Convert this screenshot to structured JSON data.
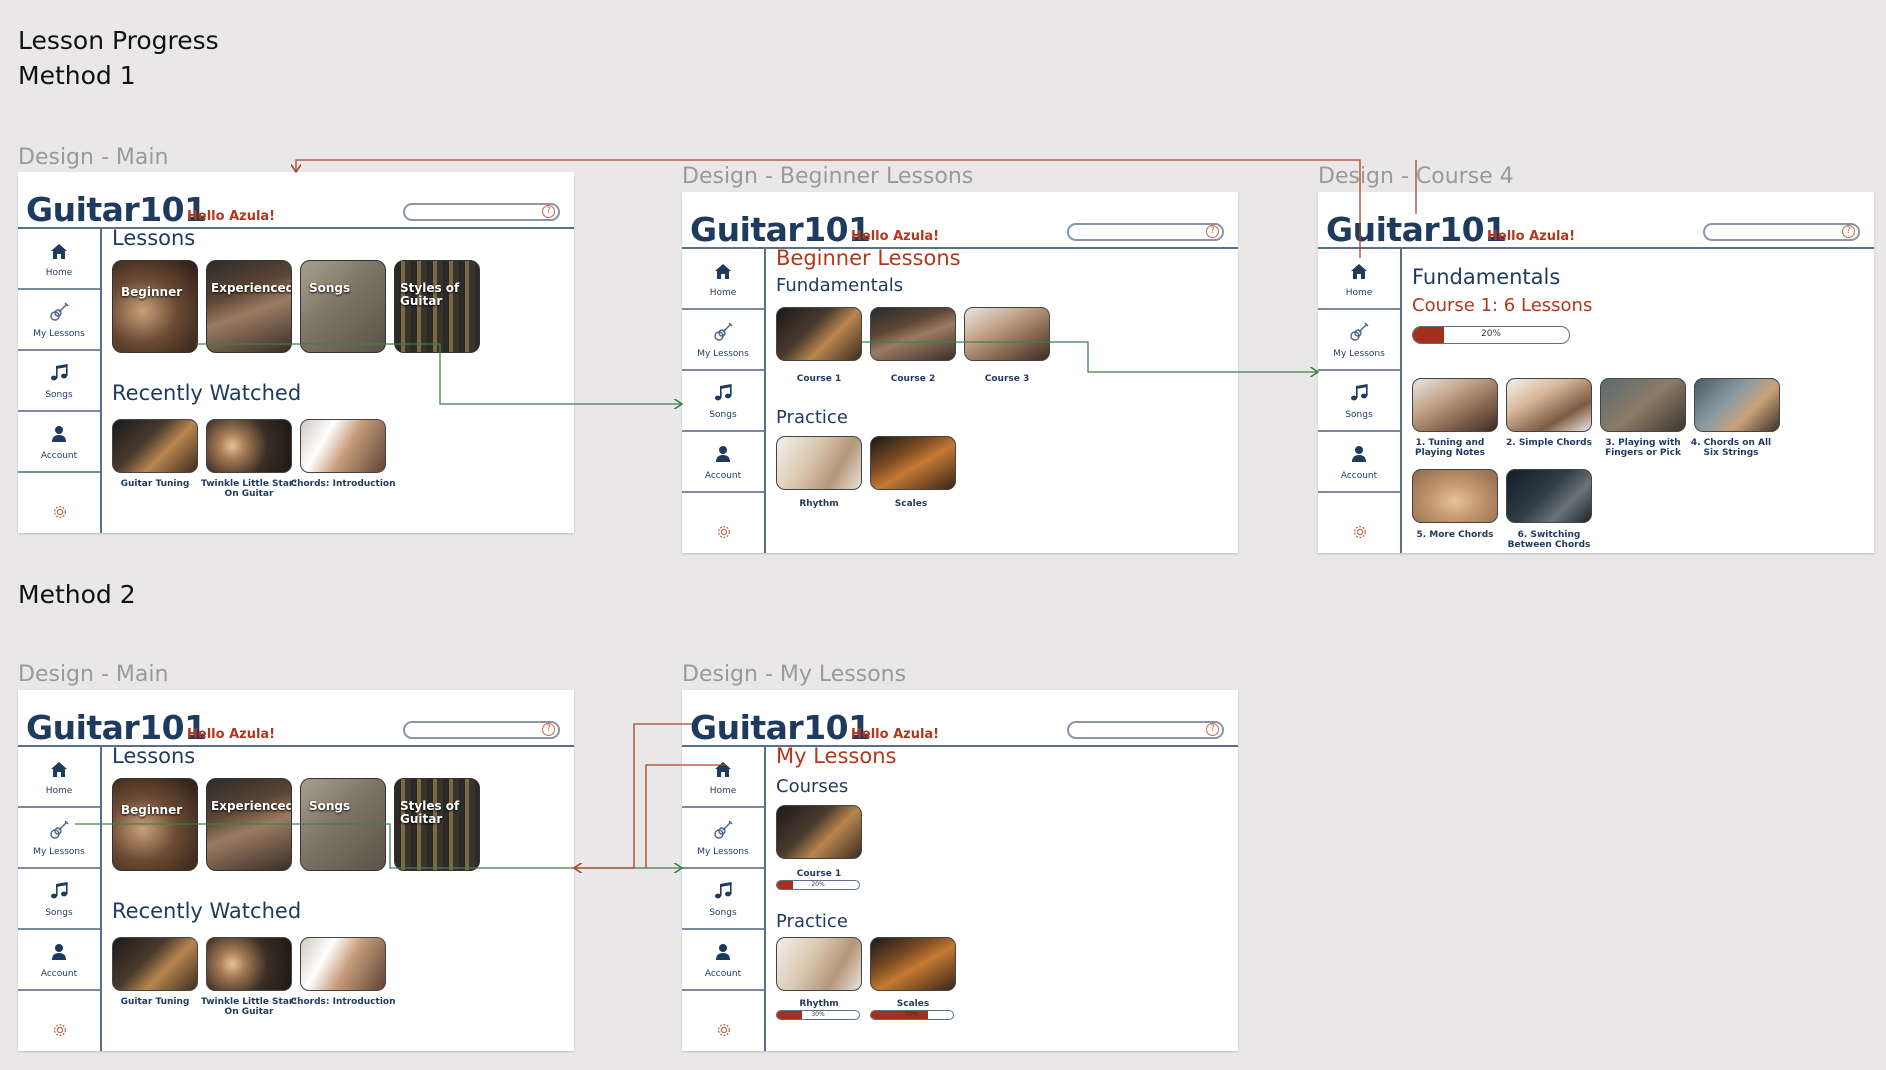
{
  "headings": {
    "title": "Lesson Progress",
    "method1": "Method 1",
    "method2": "Method 2"
  },
  "frame_labels": {
    "main1": "Design -  Main",
    "beginner": "Design -  Beginner Lessons",
    "course4": "Design -  Course 4",
    "main2": "Design -  Main",
    "mylessons": "Design -  My Lessons"
  },
  "app": {
    "brand": "Guitar101",
    "greeting": "Hello Azula!"
  },
  "nav": [
    {
      "label": "Home",
      "icon": "home-icon"
    },
    {
      "label": "My Lessons",
      "icon": "guitar-icon"
    },
    {
      "label": "Songs",
      "icon": "music-note-icon"
    },
    {
      "label": "Account",
      "icon": "person-icon"
    }
  ],
  "main": {
    "lessons_title": "Lessons",
    "lesson_tiles": [
      {
        "label": "Beginner"
      },
      {
        "label": "Experienced"
      },
      {
        "label": "Songs"
      },
      {
        "label": "Styles of Guitar"
      }
    ],
    "recent_title": "Recently Watched",
    "recent": [
      {
        "label": "Guitar Tuning"
      },
      {
        "label": "Twinkle Little Star: On Guitar"
      },
      {
        "label": "Chords: Introduction"
      }
    ]
  },
  "beginner": {
    "title": "Beginner Lessons",
    "fundamentals_title": "Fundamentals",
    "courses": [
      {
        "label": "Course 1"
      },
      {
        "label": "Course 2"
      },
      {
        "label": "Course 3"
      }
    ],
    "practice_title": "Practice",
    "practice": [
      {
        "label": "Rhythm"
      },
      {
        "label": "Scales"
      }
    ]
  },
  "course4": {
    "title": "Fundamentals",
    "subtitle": "Course 1: 6 Lessons",
    "progress": {
      "value": 0.2,
      "label": "20%"
    },
    "lessons": [
      {
        "label": "1. Tuning and Playing Notes"
      },
      {
        "label": "2. Simple Chords"
      },
      {
        "label": "3. Playing with Fingers or Pick"
      },
      {
        "label": "4. Chords on All Six Strings"
      },
      {
        "label": "5. More Chords"
      },
      {
        "label": "6. Switching Between Chords"
      }
    ]
  },
  "mylessons": {
    "title": "My Lessons",
    "courses_title": "Courses",
    "course": {
      "label": "Course 1",
      "progress": 0.2,
      "progress_label": "20%"
    },
    "practice_title": "Practice",
    "practice": [
      {
        "label": "Rhythm",
        "progress": 0.3,
        "progress_label": "30%"
      },
      {
        "label": "Scales",
        "progress": 0.7,
        "progress_label": "70%"
      }
    ]
  },
  "colors": {
    "brand_blue": "#1e3a5f",
    "accent_red": "#b3371d",
    "progress_fill": "#a3301a",
    "link_green": "#3f7f4a",
    "link_red": "#a3442a"
  }
}
